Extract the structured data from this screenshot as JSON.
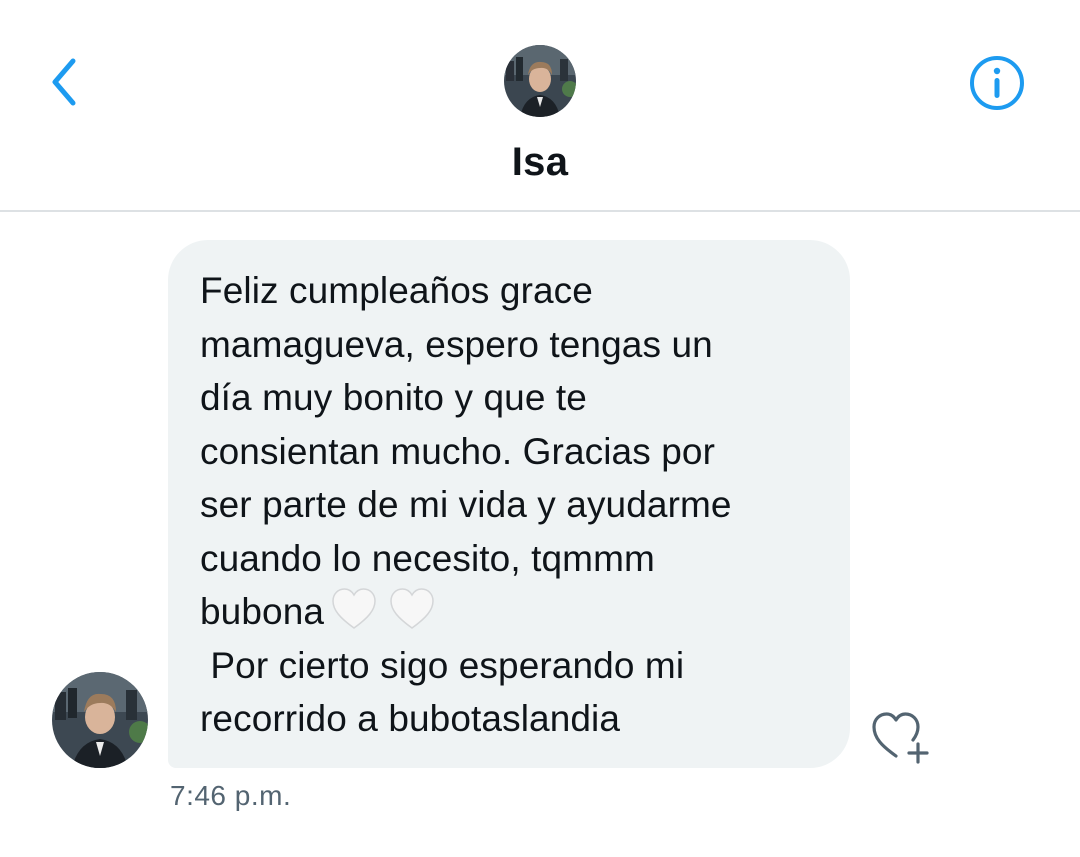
{
  "header": {
    "back_icon": "chevron-left-icon",
    "info_icon": "info-circle-icon",
    "contact_name": "Isa",
    "accent_color": "#1d9bf0"
  },
  "message": {
    "lines": [
      "Feliz cumpleaños grace",
      "mamagueva, espero tengas un",
      "día muy bonito y que te",
      "consientan mucho. Gracias por",
      "ser parte de mi vida y ayudarme",
      "cuando lo necesito, tqmmm",
      "bubona",
      " Por cierto sigo esperando mi",
      "recorrido a bubotaslandia"
    ],
    "emojis": [
      "white-heart",
      "white-heart"
    ],
    "bubble_color": "#eff3f4",
    "timestamp": "7:46 p.m."
  },
  "actions": {
    "react_icon": "heart-plus-icon"
  }
}
